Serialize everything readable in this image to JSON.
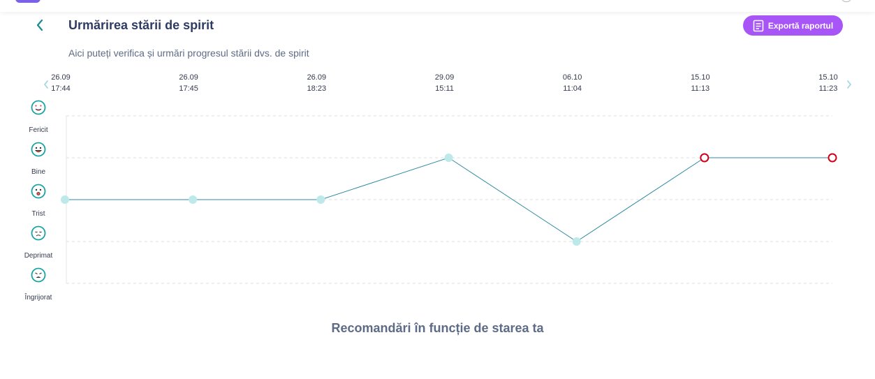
{
  "header": {
    "title": "Urmărirea stării de spirit",
    "subtitle": "Aici puteți verifica și urmări progresul stării dvs. de spirit",
    "export_label": "Exportă raportul"
  },
  "colors": {
    "accent": "#a855f7",
    "line": "#2e8ba3",
    "point": "#bde9ea",
    "point_highlight": "#d0021b",
    "face": "#1aa3a3",
    "title": "#2f3b63"
  },
  "icons": {
    "back": "chevron-left-icon",
    "export": "document-icon",
    "nav_prev": "chevron-left-icon",
    "nav_next": "chevron-right-icon"
  },
  "chart_data": {
    "type": "line",
    "x": [
      "26.09 17:44",
      "26.09 17:45",
      "26.09 18:23",
      "29.09 15:11",
      "06.10 11:04",
      "15.10 11:13",
      "15.10 11:23"
    ],
    "x_dates": [
      "26.09",
      "26.09",
      "26.09",
      "29.09",
      "06.10",
      "15.10",
      "15.10"
    ],
    "x_times": [
      "17:44",
      "17:45",
      "18:23",
      "15:11",
      "11:04",
      "11:13",
      "11:23"
    ],
    "y_levels": [
      "Fericit",
      "Bine",
      "Trist",
      "Deprimat",
      "Îngrijorat"
    ],
    "values": [
      "Trist",
      "Trist",
      "Trist",
      "Bine",
      "Deprimat",
      "Bine",
      "Bine"
    ],
    "highlighted": [
      false,
      false,
      false,
      false,
      false,
      true,
      true
    ],
    "grid": true
  },
  "recommendations": {
    "title": "Recomandări în funcție de starea ta"
  }
}
